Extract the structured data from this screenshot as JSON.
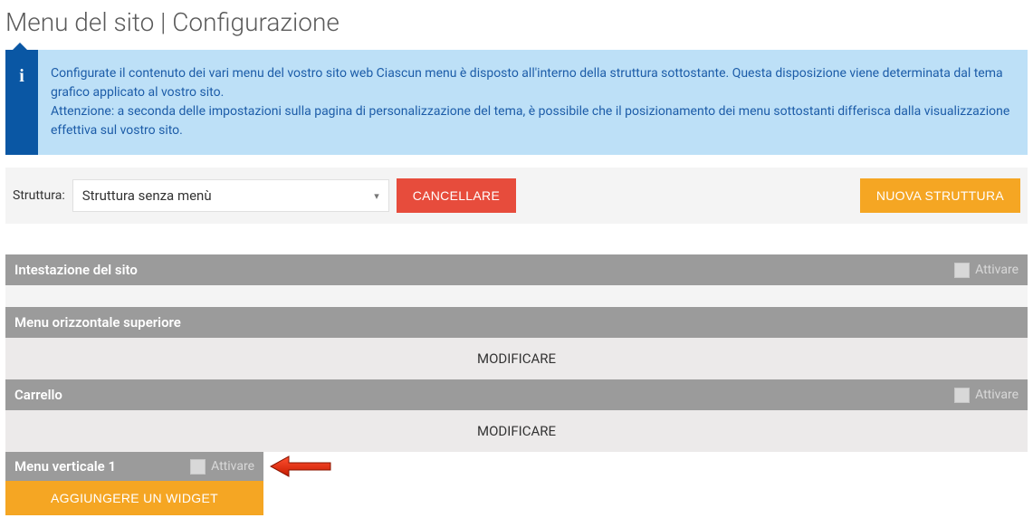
{
  "title": "Menu del sito | Configurazione",
  "info": {
    "line1": "Configurate il contenuto dei vari menu del vostro sito web Ciascun menu è disposto all'interno della struttura sottostante. Questa disposizione viene determinata dal tema grafico applicato al vostro sito.",
    "line2": "Attenzione: a seconda delle impostazioni sulla pagina di personalizzazione del tema, è possibile che il posizionamento dei menu sottostanti differisca dalla visualizzazione effettiva sul vostro sito."
  },
  "toolbar": {
    "structure_label": "Struttura:",
    "structure_selected": "Struttura senza menù",
    "cancel": "CANCELLARE",
    "new_structure": "NUOVA STRUTTURA"
  },
  "sections": {
    "site_header": {
      "title": "Intestazione del sito",
      "activate": "Attivare"
    },
    "top_menu": {
      "title": "Menu orizzontale superiore",
      "modify": "MODIFICARE"
    },
    "cart": {
      "title": "Carrello",
      "activate": "Attivare",
      "modify": "MODIFICARE"
    },
    "vertical1": {
      "title": "Menu verticale 1",
      "activate": "Attivare"
    }
  },
  "add_widget": "AGGIUNGERE UN WIDGET"
}
